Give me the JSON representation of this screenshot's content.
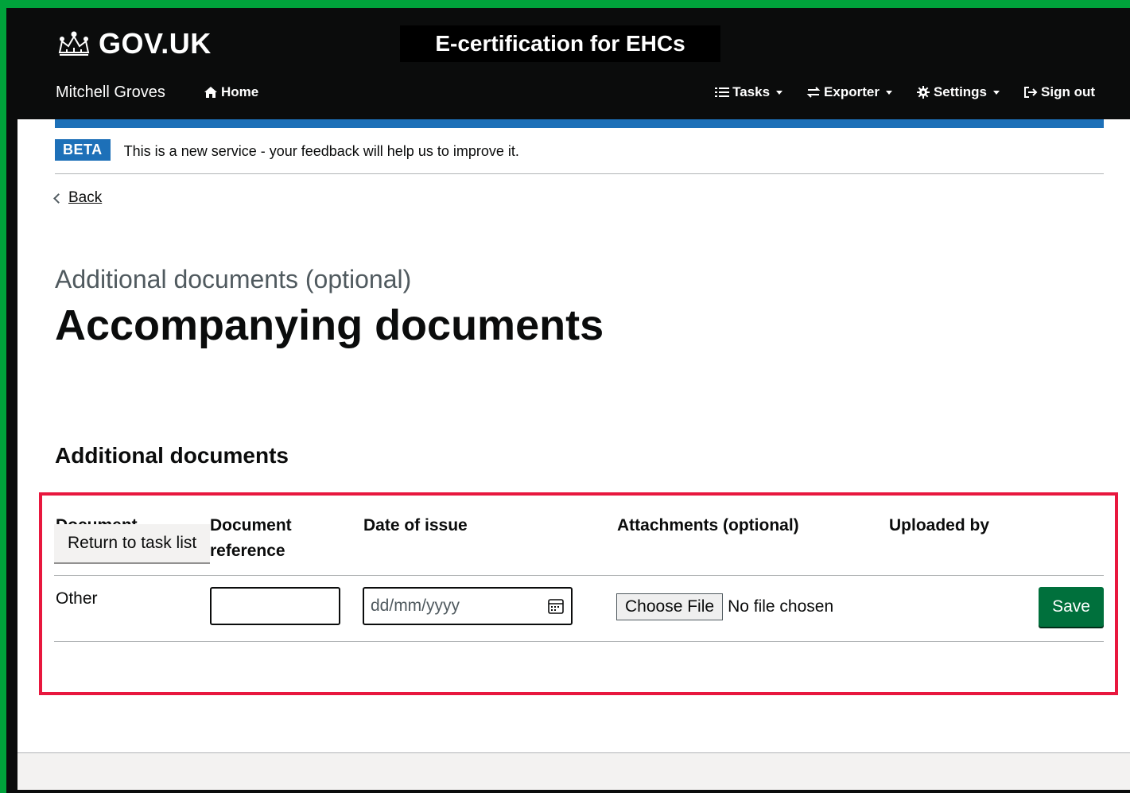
{
  "header": {
    "logo_text": "GOV.UK",
    "service_title": "E-certification for EHCs",
    "user_name": "Mitchell Groves",
    "home_label": "Home",
    "nav": [
      {
        "label": "Tasks",
        "icon": "list-icon"
      },
      {
        "label": "Exporter",
        "icon": "exchange-icon"
      },
      {
        "label": "Settings",
        "icon": "gear-icon"
      },
      {
        "label": "Sign out",
        "icon": "sign-out-icon"
      }
    ]
  },
  "phase_banner": {
    "tag": "BETA",
    "text": "This is a new service - your feedback will help us to improve it."
  },
  "back_link": "Back",
  "caption": "Additional documents (optional)",
  "page_title": "Accompanying documents",
  "section_title": "Additional documents",
  "table": {
    "headers": [
      "Document type",
      "Document reference",
      "Date of issue",
      "Attachments (optional)",
      "Uploaded by"
    ],
    "row": {
      "document_type": "Other",
      "reference_value": "",
      "date_placeholder": "dd/mm/yyyy",
      "file_button": "Choose File",
      "file_status": "No file chosen",
      "uploaded_by": "",
      "save_label": "Save"
    }
  },
  "return_label": "Return to task list",
  "colors": {
    "header_bg": "#0b0c0c",
    "brand_blue": "#1d70b8",
    "save_green": "#00703c",
    "highlight_red": "#e8173e",
    "outer_green": "#00a33b"
  }
}
